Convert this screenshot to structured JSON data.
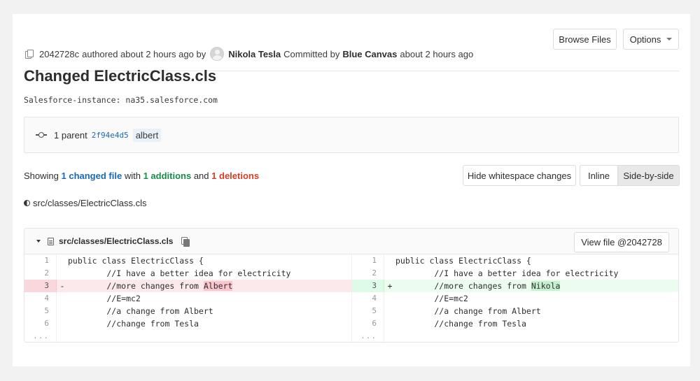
{
  "commit": {
    "sha": "2042728c",
    "authored_text": "authored about 2 hours ago by",
    "author": "Nikola Tesla",
    "committed_by_text": "Committed by",
    "committer": "Blue Canvas",
    "committed_time": "about 2 hours ago"
  },
  "buttons": {
    "browse_files": "Browse Files",
    "options": "Options"
  },
  "title": "Changed ElectricClass.cls",
  "instance": "Salesforce-instance: na35.salesforce.com",
  "parent": {
    "label": "1 parent",
    "sha": "2f94e4d5",
    "branch": "albert"
  },
  "stats": {
    "showing": "Showing",
    "changed_files": "1 changed file",
    "with": "with",
    "additions": "1 additions",
    "and": "and",
    "deletions": "1 deletions"
  },
  "view_controls": {
    "hide_whitespace": "Hide whitespace changes",
    "inline": "Inline",
    "side_by_side": "Side-by-side"
  },
  "file_path": "src/classes/ElectricClass.cls",
  "diff": {
    "file_name": "src/classes/ElectricClass.cls",
    "view_file": "View file @2042728",
    "ellipsis": "...",
    "minus": "-",
    "plus": "+",
    "left": [
      {
        "num": "1",
        "code": "public class ElectricClass {"
      },
      {
        "num": "2",
        "code": "        //I have a better idea for electricity"
      },
      {
        "num": "3",
        "code": "        //more changes from ",
        "highlight": "Albert"
      },
      {
        "num": "4",
        "code": "        //E=mc2"
      },
      {
        "num": "5",
        "code": "        //a change from Albert"
      },
      {
        "num": "6",
        "code": "        //change from Tesla"
      }
    ],
    "right": [
      {
        "num": "1",
        "code": "public class ElectricClass {"
      },
      {
        "num": "2",
        "code": "        //I have a better idea for electricity"
      },
      {
        "num": "3",
        "code": "        //more changes from ",
        "highlight": "Nikola"
      },
      {
        "num": "4",
        "code": "        //E=mc2"
      },
      {
        "num": "5",
        "code": "        //a change from Albert"
      },
      {
        "num": "6",
        "code": "        //change from Tesla"
      }
    ]
  }
}
